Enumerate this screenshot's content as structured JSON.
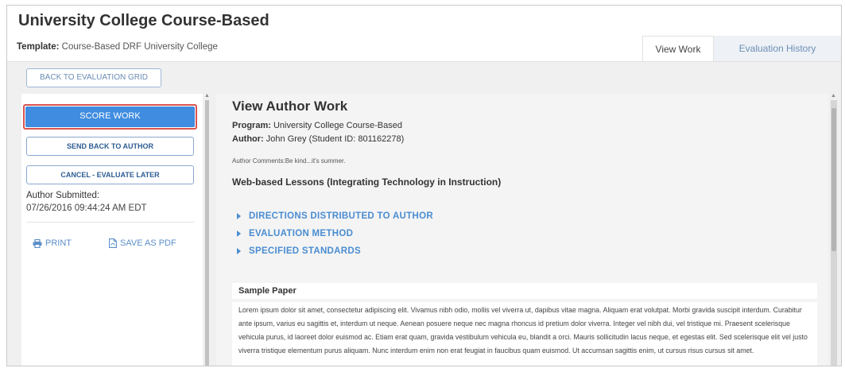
{
  "page": {
    "title": "University College Course-Based",
    "template_label": "Template:",
    "template_value": "Course-Based DRF University College"
  },
  "tabs": [
    {
      "label": "View Work",
      "active": true
    },
    {
      "label": "Evaluation History",
      "active": false
    }
  ],
  "toolbar": {
    "back_label": "BACK TO EVALUATION GRID"
  },
  "sidebar": {
    "score_label": "SCORE WORK",
    "send_back_label": "SEND BACK TO AUTHOR",
    "cancel_label": "CANCEL - EVALUATE LATER",
    "submitted_label": "Author Submitted:",
    "submitted_date": "07/26/2016 09:44:24 AM EDT",
    "print_label": "PRINT",
    "pdf_label": "SAVE AS PDF"
  },
  "content": {
    "title": "View Author Work",
    "program_label": "Program:",
    "program_value": "University College Course-Based",
    "author_label": "Author:",
    "author_value": "John Grey (Student ID: 801162278)",
    "comments": "Author Comments:Be kind...it's summer.",
    "lesson_title": "Web-based Lessons (Integrating Technology in Instruction)",
    "sections": [
      "DIRECTIONS DISTRIBUTED TO AUTHOR",
      "EVALUATION METHOD",
      "SPECIFIED STANDARDS"
    ],
    "sample_heading": "Sample Paper",
    "sample_text": "Lorem ipsum dolor sit amet, consectetur adipiscing elit. Vivamus nibh odio, mollis vel viverra ut, dapibus vitae magna. Aliquam erat volutpat. Morbi gravida suscipit interdum. Curabitur ante ipsum, varius eu sagittis et, interdum ut neque. Aenean posuere neque nec magna rhoncus id pretium dolor viverra. Integer vel nibh dui, vel tristique mi. Praesent scelerisque vehicula purus, id laoreet dolor euismod ac. Etiam erat quam, gravida vestibulum vehicula eu, blandit a orci. Mauris sollicitudin lacus neque, et egestas elit. Sed scelerisque elit vel justo viverra tristique elementum purus aliquam. Nunc interdum enim non erat feugiat in faucibus quam euismod. Ut accumsan sagittis enim, ut cursus risus cursus sit amet."
  },
  "colors": {
    "primary": "#3f8ce0",
    "highlight_border": "#d9534f",
    "link": "#4a8dd1"
  }
}
